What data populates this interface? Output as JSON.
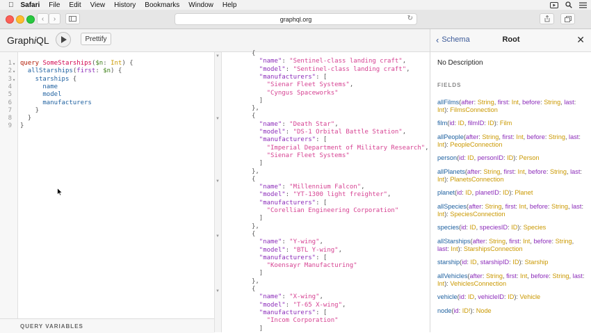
{
  "menubar": {
    "app": "Safari",
    "items": [
      "File",
      "Edit",
      "View",
      "History",
      "Bookmarks",
      "Window",
      "Help"
    ]
  },
  "browser": {
    "url": "graphql.org"
  },
  "graphiql": {
    "logo_prefix": "Graph",
    "logo_i": "i",
    "logo_suffix": "QL",
    "prettify_label": "Prettify",
    "query_variables_label": "QUERY VARIABLES",
    "line_numbers": [
      "1",
      "2",
      "3",
      "4",
      "5",
      "6",
      "7",
      "8",
      "9"
    ],
    "query": {
      "l1": [
        "query",
        " ",
        "SomeStarships",
        "(",
        "$n",
        ": ",
        "Int",
        ") {"
      ],
      "l2": [
        "allStarships",
        "(",
        "first",
        ": ",
        "$n",
        ") {"
      ],
      "l3": [
        "starships",
        " {"
      ],
      "l4": "name",
      "l5": "model",
      "l6": "manufacturers",
      "l7": "}",
      "l8": "}",
      "l9": "}"
    }
  },
  "result": [
    {
      "indent": 0,
      "parts": [
        {
          "t": "{",
          "c": "punc"
        }
      ]
    },
    {
      "indent": 1,
      "parts": [
        {
          "t": "\"name\"",
          "c": "attr"
        },
        {
          "t": ": ",
          "c": "punc"
        },
        {
          "t": "\"Sentinel-class landing craft\"",
          "c": "str"
        },
        {
          "t": ",",
          "c": "punc"
        }
      ]
    },
    {
      "indent": 1,
      "parts": [
        {
          "t": "\"model\"",
          "c": "attr"
        },
        {
          "t": ": ",
          "c": "punc"
        },
        {
          "t": "\"Sentinel-class landing craft\"",
          "c": "str"
        },
        {
          "t": ",",
          "c": "punc"
        }
      ]
    },
    {
      "indent": 1,
      "parts": [
        {
          "t": "\"manufacturers\"",
          "c": "attr"
        },
        {
          "t": ": [",
          "c": "punc"
        }
      ]
    },
    {
      "indent": 2,
      "parts": [
        {
          "t": "\"Sienar Fleet Systems\"",
          "c": "str"
        },
        {
          "t": ",",
          "c": "punc"
        }
      ]
    },
    {
      "indent": 2,
      "parts": [
        {
          "t": "\"Cyngus Spaceworks\"",
          "c": "str"
        }
      ]
    },
    {
      "indent": 1,
      "parts": [
        {
          "t": "]",
          "c": "punc"
        }
      ]
    },
    {
      "indent": 0,
      "parts": [
        {
          "t": "},",
          "c": "punc"
        }
      ]
    },
    {
      "indent": 0,
      "parts": [
        {
          "t": "{",
          "c": "punc"
        }
      ]
    },
    {
      "indent": 1,
      "parts": [
        {
          "t": "\"name\"",
          "c": "attr"
        },
        {
          "t": ": ",
          "c": "punc"
        },
        {
          "t": "\"Death Star\"",
          "c": "str"
        },
        {
          "t": ",",
          "c": "punc"
        }
      ]
    },
    {
      "indent": 1,
      "parts": [
        {
          "t": "\"model\"",
          "c": "attr"
        },
        {
          "t": ": ",
          "c": "punc"
        },
        {
          "t": "\"DS-1 Orbital Battle Station\"",
          "c": "str"
        },
        {
          "t": ",",
          "c": "punc"
        }
      ]
    },
    {
      "indent": 1,
      "parts": [
        {
          "t": "\"manufacturers\"",
          "c": "attr"
        },
        {
          "t": ": [",
          "c": "punc"
        }
      ]
    },
    {
      "indent": 2,
      "parts": [
        {
          "t": "\"Imperial Department of Military Research\"",
          "c": "str"
        },
        {
          "t": ",",
          "c": "punc"
        }
      ]
    },
    {
      "indent": 2,
      "parts": [
        {
          "t": "\"Sienar Fleet Systems\"",
          "c": "str"
        }
      ]
    },
    {
      "indent": 1,
      "parts": [
        {
          "t": "]",
          "c": "punc"
        }
      ]
    },
    {
      "indent": 0,
      "parts": [
        {
          "t": "},",
          "c": "punc"
        }
      ]
    },
    {
      "indent": 0,
      "parts": [
        {
          "t": "{",
          "c": "punc"
        }
      ]
    },
    {
      "indent": 1,
      "parts": [
        {
          "t": "\"name\"",
          "c": "attr"
        },
        {
          "t": ": ",
          "c": "punc"
        },
        {
          "t": "\"Millennium Falcon\"",
          "c": "str"
        },
        {
          "t": ",",
          "c": "punc"
        }
      ]
    },
    {
      "indent": 1,
      "parts": [
        {
          "t": "\"model\"",
          "c": "attr"
        },
        {
          "t": ": ",
          "c": "punc"
        },
        {
          "t": "\"YT-1300 light freighter\"",
          "c": "str"
        },
        {
          "t": ",",
          "c": "punc"
        }
      ]
    },
    {
      "indent": 1,
      "parts": [
        {
          "t": "\"manufacturers\"",
          "c": "attr"
        },
        {
          "t": ": [",
          "c": "punc"
        }
      ]
    },
    {
      "indent": 2,
      "parts": [
        {
          "t": "\"Corellian Engineering Corporation\"",
          "c": "str"
        }
      ]
    },
    {
      "indent": 1,
      "parts": [
        {
          "t": "]",
          "c": "punc"
        }
      ]
    },
    {
      "indent": 0,
      "parts": [
        {
          "t": "},",
          "c": "punc"
        }
      ]
    },
    {
      "indent": 0,
      "parts": [
        {
          "t": "{",
          "c": "punc"
        }
      ]
    },
    {
      "indent": 1,
      "parts": [
        {
          "t": "\"name\"",
          "c": "attr"
        },
        {
          "t": ": ",
          "c": "punc"
        },
        {
          "t": "\"Y-wing\"",
          "c": "str"
        },
        {
          "t": ",",
          "c": "punc"
        }
      ]
    },
    {
      "indent": 1,
      "parts": [
        {
          "t": "\"model\"",
          "c": "attr"
        },
        {
          "t": ": ",
          "c": "punc"
        },
        {
          "t": "\"BTL Y-wing\"",
          "c": "str"
        },
        {
          "t": ",",
          "c": "punc"
        }
      ]
    },
    {
      "indent": 1,
      "parts": [
        {
          "t": "\"manufacturers\"",
          "c": "attr"
        },
        {
          "t": ": [",
          "c": "punc"
        }
      ]
    },
    {
      "indent": 2,
      "parts": [
        {
          "t": "\"Koensayr Manufacturing\"",
          "c": "str"
        }
      ]
    },
    {
      "indent": 1,
      "parts": [
        {
          "t": "]",
          "c": "punc"
        }
      ]
    },
    {
      "indent": 0,
      "parts": [
        {
          "t": "},",
          "c": "punc"
        }
      ]
    },
    {
      "indent": 0,
      "parts": [
        {
          "t": "{",
          "c": "punc"
        }
      ]
    },
    {
      "indent": 1,
      "parts": [
        {
          "t": "\"name\"",
          "c": "attr"
        },
        {
          "t": ": ",
          "c": "punc"
        },
        {
          "t": "\"X-wing\"",
          "c": "str"
        },
        {
          "t": ",",
          "c": "punc"
        }
      ]
    },
    {
      "indent": 1,
      "parts": [
        {
          "t": "\"model\"",
          "c": "attr"
        },
        {
          "t": ": ",
          "c": "punc"
        },
        {
          "t": "\"T-65 X-wing\"",
          "c": "str"
        },
        {
          "t": ",",
          "c": "punc"
        }
      ]
    },
    {
      "indent": 1,
      "parts": [
        {
          "t": "\"manufacturers\"",
          "c": "attr"
        },
        {
          "t": ": [",
          "c": "punc"
        }
      ]
    },
    {
      "indent": 2,
      "parts": [
        {
          "t": "\"Incom Corporation\"",
          "c": "str"
        }
      ]
    },
    {
      "indent": 1,
      "parts": [
        {
          "t": "]",
          "c": "punc"
        }
      ]
    }
  ],
  "docs": {
    "back_label": "Schema",
    "title": "Root",
    "description": "No Description",
    "fields_header": "FIELDS",
    "fields": [
      {
        "name": "allFilms",
        "args": [
          [
            "after",
            "String"
          ],
          [
            "first",
            "Int"
          ],
          [
            "before",
            "String"
          ],
          [
            "last",
            "Int"
          ]
        ],
        "type": "FilmsConnection"
      },
      {
        "name": "film",
        "args": [
          [
            "id",
            "ID"
          ],
          [
            "filmID",
            "ID"
          ]
        ],
        "type": "Film"
      },
      {
        "name": "allPeople",
        "args": [
          [
            "after",
            "String"
          ],
          [
            "first",
            "Int"
          ],
          [
            "before",
            "String"
          ],
          [
            "last",
            "Int"
          ]
        ],
        "type": "PeopleConnection"
      },
      {
        "name": "person",
        "args": [
          [
            "id",
            "ID"
          ],
          [
            "personID",
            "ID"
          ]
        ],
        "type": "Person"
      },
      {
        "name": "allPlanets",
        "args": [
          [
            "after",
            "String"
          ],
          [
            "first",
            "Int"
          ],
          [
            "before",
            "String"
          ],
          [
            "last",
            "Int"
          ]
        ],
        "type": "PlanetsConnection"
      },
      {
        "name": "planet",
        "args": [
          [
            "id",
            "ID"
          ],
          [
            "planetID",
            "ID"
          ]
        ],
        "type": "Planet"
      },
      {
        "name": "allSpecies",
        "args": [
          [
            "after",
            "String"
          ],
          [
            "first",
            "Int"
          ],
          [
            "before",
            "String"
          ],
          [
            "last",
            "Int"
          ]
        ],
        "type": "SpeciesConnection"
      },
      {
        "name": "species",
        "args": [
          [
            "id",
            "ID"
          ],
          [
            "speciesID",
            "ID"
          ]
        ],
        "type": "Species"
      },
      {
        "name": "allStarships",
        "args": [
          [
            "after",
            "String"
          ],
          [
            "first",
            "Int"
          ],
          [
            "before",
            "String"
          ],
          [
            "last",
            "Int"
          ]
        ],
        "type": "StarshipsConnection"
      },
      {
        "name": "starship",
        "args": [
          [
            "id",
            "ID"
          ],
          [
            "starshipID",
            "ID"
          ]
        ],
        "type": "Starship"
      },
      {
        "name": "allVehicles",
        "args": [
          [
            "after",
            "String"
          ],
          [
            "first",
            "Int"
          ],
          [
            "before",
            "String"
          ],
          [
            "last",
            "Int"
          ]
        ],
        "type": "VehiclesConnection"
      },
      {
        "name": "vehicle",
        "args": [
          [
            "id",
            "ID"
          ],
          [
            "vehicleID",
            "ID"
          ]
        ],
        "type": "Vehicle"
      },
      {
        "name": "node",
        "args": [
          [
            "id",
            "ID!"
          ]
        ],
        "type": "Node"
      }
    ]
  },
  "icons": {
    "apple": "apple-icon",
    "back": "chevron-left-icon",
    "forward": "chevron-right-icon",
    "sidebar": "sidebar-icon",
    "reload": "reload-icon",
    "share": "share-icon",
    "tabs": "tabs-icon",
    "run": "play-icon",
    "close": "close-icon",
    "cursor": "mouse-cursor-icon"
  },
  "colors": {
    "keyword": "#b11a04",
    "definition": "#d2054e",
    "variable": "#397d13",
    "type": "#ca9800",
    "property": "#1f61a0",
    "attribute": "#8b2bb9",
    "string": "#d64292"
  }
}
